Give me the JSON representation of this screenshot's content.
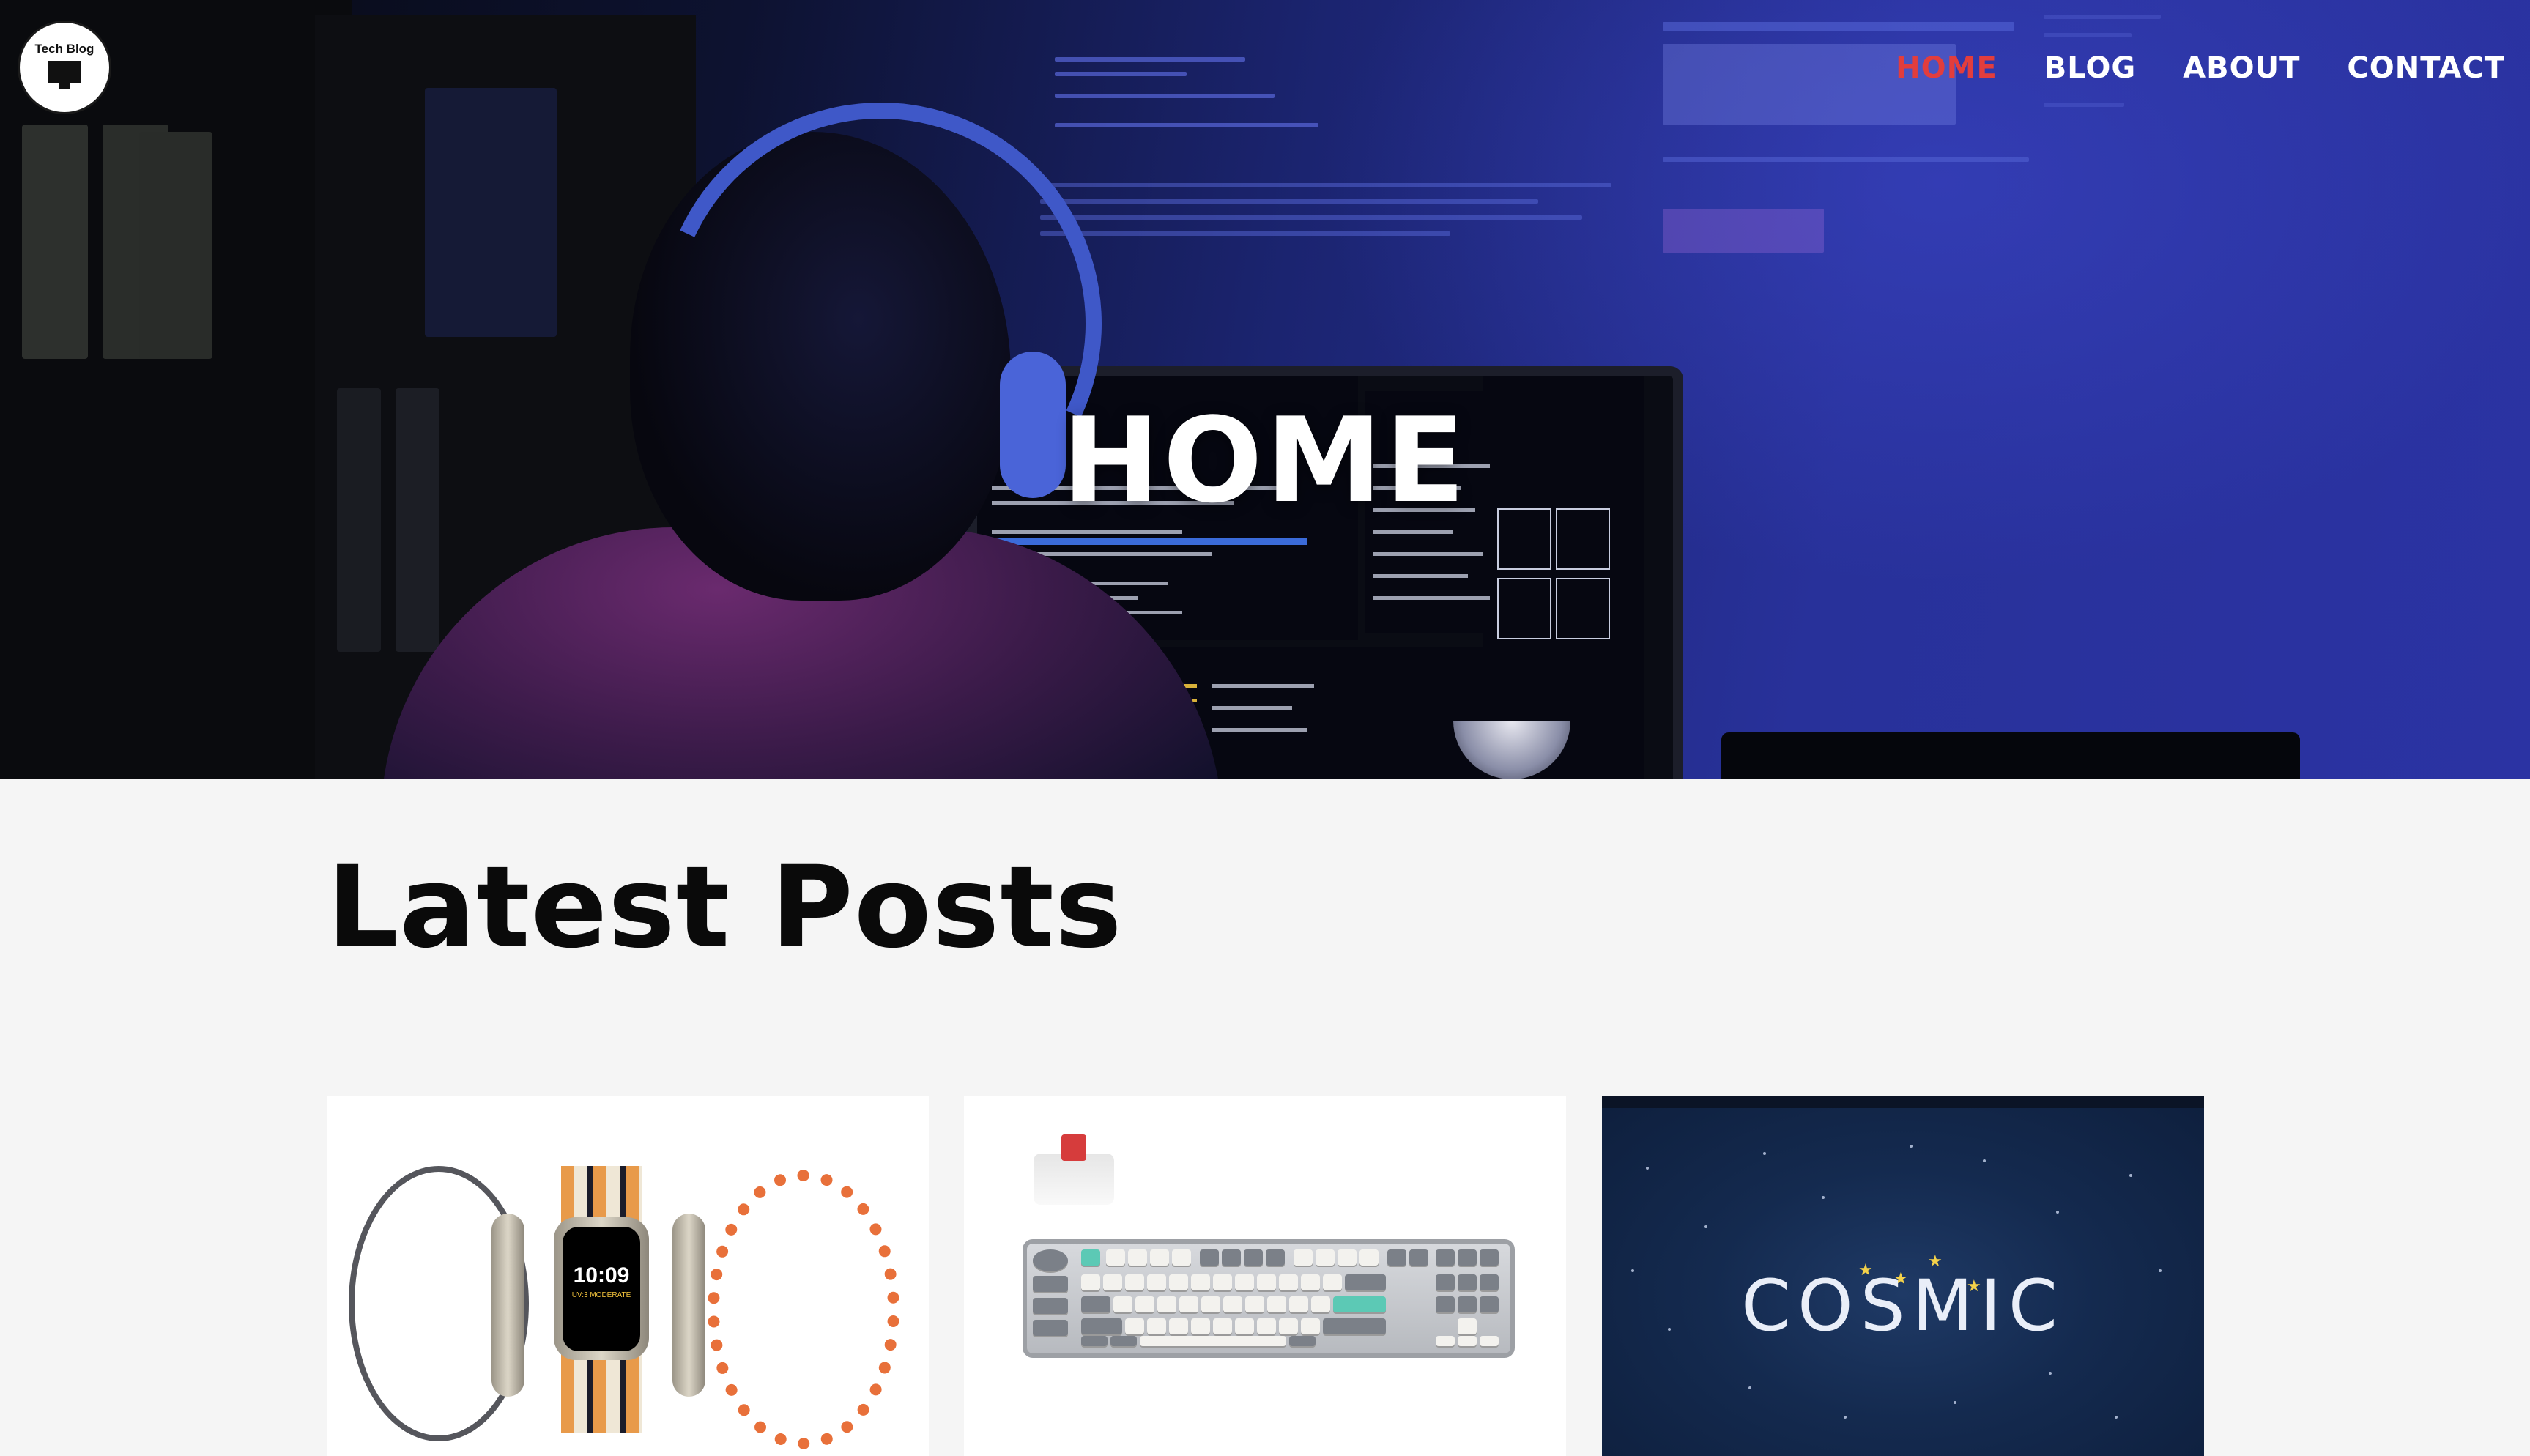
{
  "site": {
    "logo_text": "Tech Blog"
  },
  "nav": {
    "items": [
      {
        "label": "HOME",
        "active": true
      },
      {
        "label": "BLOG",
        "active": false
      },
      {
        "label": "ABOUT",
        "active": false
      },
      {
        "label": "CONTACT",
        "active": false
      }
    ],
    "active_color": "#e23d3d"
  },
  "hero": {
    "title": "HOME"
  },
  "main": {
    "section_title": "Latest Posts",
    "cards": [
      {
        "image": "smartwatch-product-image",
        "screen_time": "10:09",
        "screen_label": "UV:3 MODERATE"
      },
      {
        "image": "mechanical-keyboard-image"
      },
      {
        "image": "cosmic-desktop-wallpaper",
        "wordmark": "COSMIC"
      }
    ]
  }
}
